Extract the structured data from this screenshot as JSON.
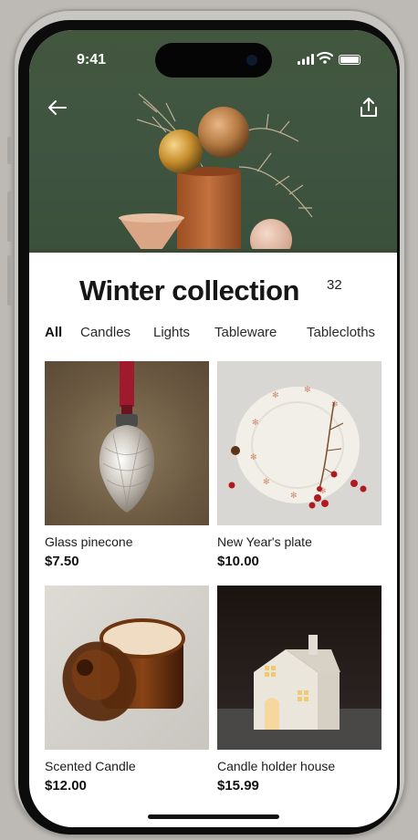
{
  "status": {
    "time": "9:41"
  },
  "collection": {
    "title": "Winter collection",
    "count": "32"
  },
  "tabs": [
    {
      "label": "All",
      "active": true
    },
    {
      "label": "Candles",
      "active": false
    },
    {
      "label": "Lights",
      "active": false
    },
    {
      "label": "Tableware",
      "active": false
    },
    {
      "label": "Tablecloths",
      "active": false
    }
  ],
  "products": [
    {
      "name": "Glass pinecone",
      "price": "$7.50"
    },
    {
      "name": "New Year's plate",
      "price": "$10.00"
    },
    {
      "name": "Scented Candle",
      "price": "$12.00"
    },
    {
      "name": "Candle holder house",
      "price": "$15.99"
    }
  ],
  "icons": {
    "back": "arrow-left-icon",
    "share": "share-icon",
    "signal": "cellular-signal-icon",
    "wifi": "wifi-icon",
    "battery": "battery-icon"
  },
  "colors": {
    "hero_background": "#43573f",
    "text_primary": "#161616",
    "screen_background": "#ffffff"
  }
}
